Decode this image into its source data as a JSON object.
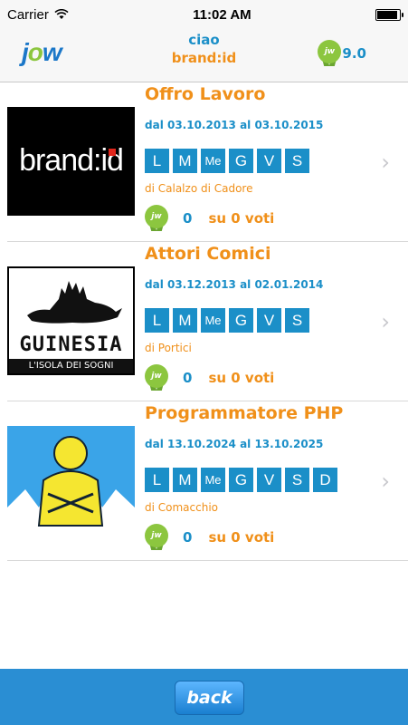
{
  "status": {
    "carrier": "Carrier",
    "time": "11:02 AM"
  },
  "header": {
    "logo_j": "j",
    "logo_o": "o",
    "logo_w": "w",
    "greeting": "ciao",
    "user": "brand:id",
    "score": "9.0",
    "medal_text": "jw"
  },
  "colors": {
    "accent_blue": "#1b8fc8",
    "accent_orange": "#f0901a",
    "green": "#8cc63f",
    "bar": "#2a8ed3"
  },
  "jobs": [
    {
      "title": "Offro Lavoro",
      "dates": "dal 03.10.2013 al 03.10.2015",
      "days": [
        "L",
        "M",
        "Me",
        "G",
        "V",
        "S"
      ],
      "city": "di Calalzo di Cadore",
      "score": "0",
      "votes": "su 0 voti",
      "thumb_text": "brand:id"
    },
    {
      "title": "Attori Comici",
      "dates": "dal 03.12.2013 al 02.01.2014",
      "days": [
        "L",
        "M",
        "Me",
        "G",
        "V",
        "S"
      ],
      "city": "di Portici",
      "score": "0",
      "votes": "su 0 voti",
      "thumb_text": "GUINESIA",
      "thumb_sub": "L'ISOLA DEI SOGNI"
    },
    {
      "title": "Programmatore PHP",
      "dates": "dal 13.10.2024 al 13.10.2025",
      "days": [
        "L",
        "M",
        "Me",
        "G",
        "V",
        "S",
        "D"
      ],
      "city": "di Comacchio",
      "score": "0",
      "votes": "su 0 voti"
    }
  ],
  "footer": {
    "back_label": "back"
  },
  "icons": {
    "chevron": "chevron-right-icon",
    "wifi": "wifi-icon",
    "battery": "battery-icon"
  }
}
